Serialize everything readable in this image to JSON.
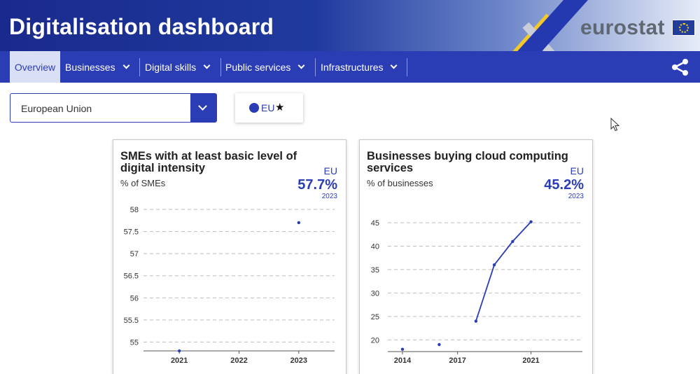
{
  "header": {
    "title": "Digitalisation dashboard",
    "brand": "eurostat"
  },
  "nav": {
    "items": [
      {
        "label": "Overview",
        "active": true,
        "dropdown": false
      },
      {
        "label": "Businesses",
        "active": false,
        "dropdown": true
      },
      {
        "label": "Digital skills",
        "active": false,
        "dropdown": true
      },
      {
        "label": "Public services",
        "active": false,
        "dropdown": true
      },
      {
        "label": "Infrastructures",
        "active": false,
        "dropdown": true
      }
    ],
    "share_icon": "share-icon"
  },
  "filter": {
    "country": "European Union"
  },
  "legend": {
    "label": "EU",
    "marker": "★",
    "color": "#2b3db5"
  },
  "colors": {
    "primary": "#2b3db5",
    "nav_active_bg": "#d9dff5",
    "header_dark": "#1a2a8c"
  },
  "cards": [
    {
      "title": "SMEs with at least basic level of digital intensity",
      "unit": "% of SMEs",
      "geo": "EU",
      "value": "57.7%",
      "year": "2023"
    },
    {
      "title": "Businesses buying cloud computing services",
      "unit": "% of businesses",
      "geo": "EU",
      "value": "45.2%",
      "year": "2023"
    }
  ],
  "chart_data": [
    {
      "type": "scatter",
      "x_ticks": [
        "2021",
        "2022",
        "2023"
      ],
      "y_ticks": [
        55,
        55.5,
        56,
        56.5,
        57,
        57.5,
        58
      ],
      "ylim": [
        54.8,
        58
      ],
      "xlim": [
        2020.4,
        2023.6
      ],
      "grid": true,
      "series": [
        {
          "points": [
            {
              "x": 2021,
              "y": 54.8
            },
            {
              "x": 2023,
              "y": 57.7
            }
          ]
        }
      ]
    },
    {
      "type": "line",
      "x_ticks": [
        "2014",
        "2017",
        "2021"
      ],
      "y_ticks": [
        20,
        25,
        30,
        35,
        40,
        45
      ],
      "ylim": [
        17.5,
        45
      ],
      "xlim": [
        2013.2,
        2023.8
      ],
      "grid": true,
      "series": [
        {
          "points": [
            {
              "x": 2014,
              "y": 18.0
            },
            {
              "x": 2016,
              "y": 19.0
            },
            {
              "x": 2018,
              "y": 24.0
            },
            {
              "x": 2019,
              "y": 36.0
            },
            {
              "x": 2020,
              "y": 41.0
            },
            {
              "x": 2021,
              "y": 45.2
            }
          ],
          "segments": [
            [
              2,
              3,
              4,
              5
            ]
          ]
        }
      ]
    }
  ]
}
